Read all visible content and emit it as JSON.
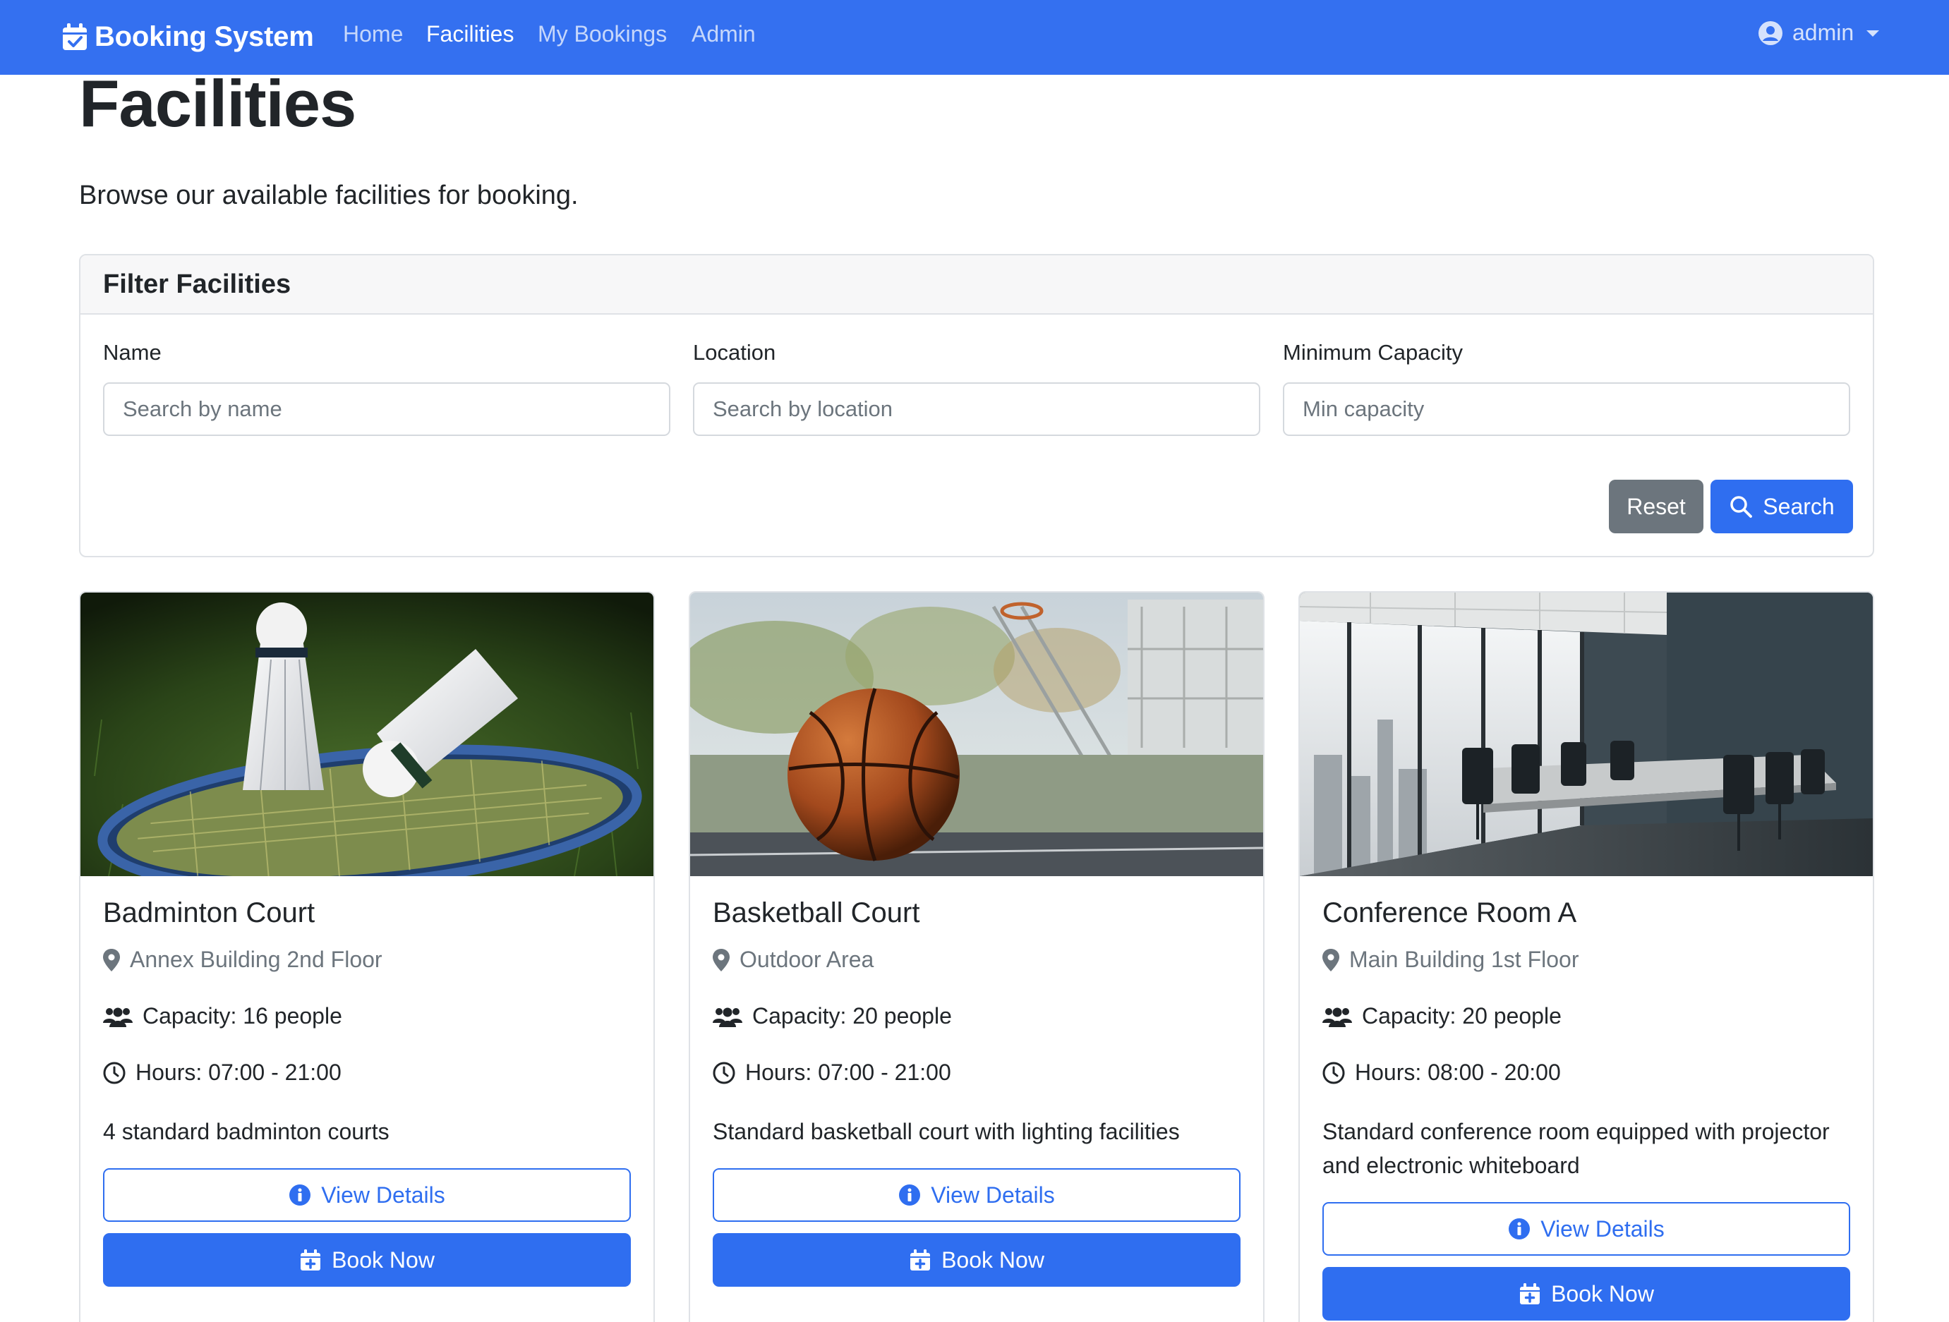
{
  "navbar": {
    "brand": "Booking System",
    "links": [
      {
        "label": "Home",
        "active": false
      },
      {
        "label": "Facilities",
        "active": true
      },
      {
        "label": "My Bookings",
        "active": false
      },
      {
        "label": "Admin",
        "active": false
      }
    ],
    "user": "admin",
    "color": "#3470f0"
  },
  "page": {
    "title": "Facilities",
    "subtitle": "Browse our available facilities for booking."
  },
  "filter": {
    "title": "Filter Facilities",
    "fields": [
      {
        "label": "Name",
        "placeholder": "Search by name",
        "value": ""
      },
      {
        "label": "Location",
        "placeholder": "Search by location",
        "value": ""
      },
      {
        "label": "Minimum Capacity",
        "placeholder": "Min capacity",
        "value": ""
      }
    ],
    "reset_label": "Reset",
    "search_label": "Search"
  },
  "facilities": [
    {
      "name": "Badminton Court",
      "location": "Annex Building 2nd Floor",
      "capacity": "Capacity: 16 people",
      "hours": "Hours: 07:00 - 21:00",
      "description": "4 standard badminton courts",
      "view_label": "View Details",
      "book_label": "Book Now"
    },
    {
      "name": "Basketball Court",
      "location": "Outdoor Area",
      "capacity": "Capacity: 20 people",
      "hours": "Hours: 07:00 - 21:00",
      "description": "Standard basketball court with lighting facilities",
      "view_label": "View Details",
      "book_label": "Book Now"
    },
    {
      "name": "Conference Room A",
      "location": "Main Building 1st Floor",
      "capacity": "Capacity: 20 people",
      "hours": "Hours: 08:00 - 20:00",
      "description": "Standard conference room equipped with projector and electronic whiteboard",
      "view_label": "View Details",
      "book_label": "Book Now"
    }
  ],
  "icons": {
    "brand": "calendar-check-icon",
    "user": "user-circle-icon",
    "search": "search-icon",
    "location": "map-marker-icon",
    "capacity": "users-icon",
    "hours": "clock-icon",
    "details": "info-circle-icon",
    "book": "calendar-plus-icon"
  },
  "colors": {
    "primary": "#2f6ef0",
    "secondary": "#6c757d"
  }
}
